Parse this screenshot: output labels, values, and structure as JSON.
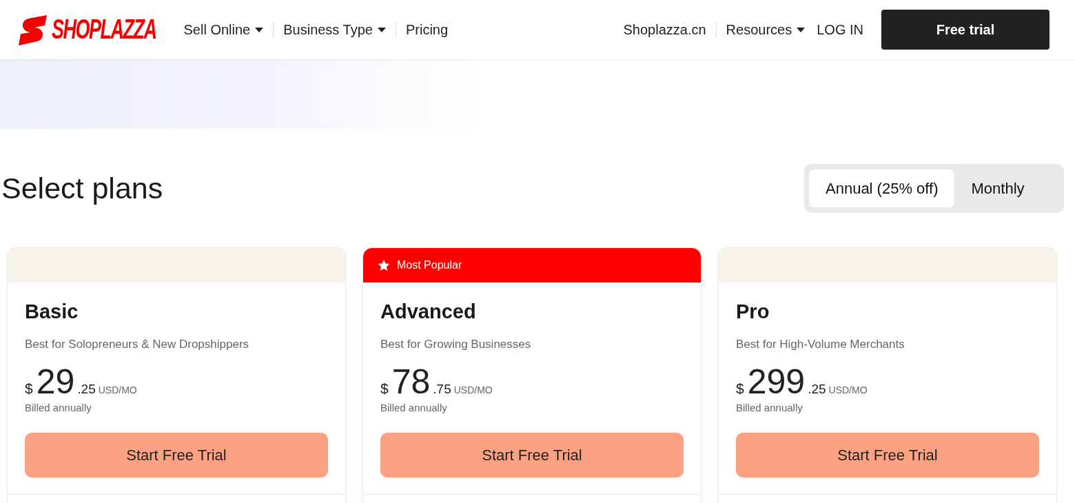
{
  "brand": {
    "name": "SHOPLAZZA"
  },
  "nav": {
    "left": [
      {
        "label": "Sell Online",
        "dropdown": true,
        "divider_before": false
      },
      {
        "label": "Business Type",
        "dropdown": true,
        "divider_before": true
      },
      {
        "label": "Pricing",
        "dropdown": false,
        "divider_before": true
      }
    ],
    "right": [
      {
        "label": "Shoplazza.cn",
        "dropdown": false,
        "divider_before": false
      },
      {
        "label": "Resources",
        "dropdown": true,
        "divider_before": true
      },
      {
        "label": "LOG IN",
        "dropdown": false,
        "divider_before": false
      }
    ],
    "cta": "Free trial"
  },
  "plans_section": {
    "title": "Select plans",
    "billing_toggle": [
      {
        "label": "Annual (25% off)",
        "selected": true
      },
      {
        "label": "Monthly",
        "selected": false
      }
    ]
  },
  "plans": [
    {
      "featured": false,
      "name": "Basic",
      "tagline": "Best for Solopreneurs & New Dropshippers",
      "currency": "$",
      "price_whole": "29",
      "price_cents": ".25",
      "unit": "USD/MO",
      "billing": "Billed annually",
      "button": "Start Free Trial"
    },
    {
      "featured": true,
      "badge": "Most Popular",
      "name": "Advanced",
      "tagline": "Best for Growing Businesses",
      "currency": "$",
      "price_whole": "78",
      "price_cents": ".75",
      "unit": "USD/MO",
      "billing": "Billed annually",
      "button": "Start Free Trial"
    },
    {
      "featured": false,
      "name": "Pro",
      "tagline": "Best for High-Volume Merchants",
      "currency": "$",
      "price_whole": "299",
      "price_cents": ".25",
      "unit": "USD/MO",
      "billing": "Billed annually",
      "button": "Start Free Trial"
    }
  ]
}
